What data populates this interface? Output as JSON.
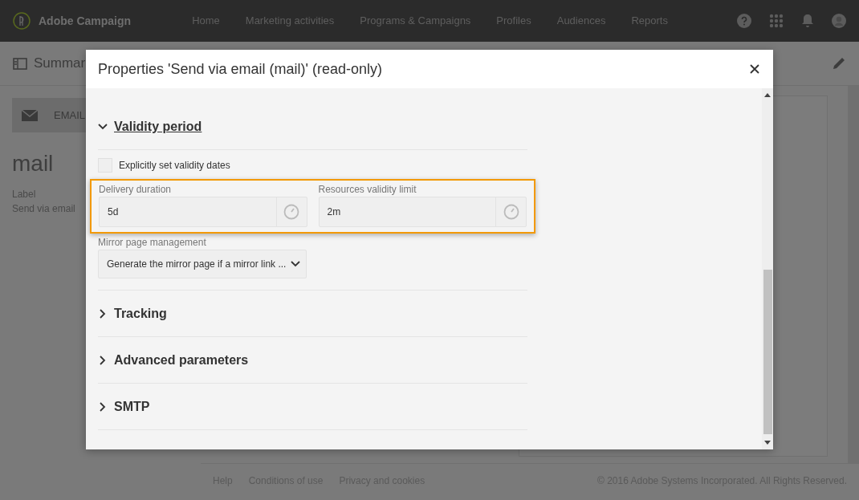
{
  "app": {
    "name": "Adobe Campaign",
    "nav": [
      {
        "label": "Home"
      },
      {
        "label": "Marketing activities"
      },
      {
        "label": "Programs & Campaigns"
      },
      {
        "label": "Profiles"
      },
      {
        "label": "Audiences"
      },
      {
        "label": "Reports"
      }
    ]
  },
  "page": {
    "summary_title": "Summar",
    "channel_tab": "EMAIL",
    "heading": "mail",
    "label_caption": "Label",
    "label_value": "Send via email"
  },
  "footer": {
    "links": [
      "Help",
      "Conditions of use",
      "Privacy and cookies"
    ],
    "copyright": "© 2016 Adobe Systems Incorporated. All Rights Reserved."
  },
  "dialog": {
    "title": "Properties 'Send via email (mail)' (read-only)",
    "sections": [
      {
        "title": "Validity period",
        "expanded": true,
        "rows": [
          {
            "kind": "checkbox",
            "label": "Explicitly set validity dates",
            "checked": false
          },
          {
            "kind": "pair",
            "highlighted": true,
            "fields": [
              {
                "label": "Delivery duration",
                "value": "5d"
              },
              {
                "label": "Resources validity limit",
                "value": "2m"
              }
            ]
          },
          {
            "kind": "select",
            "label": "Mirror page management",
            "value": "Generate the mirror page if a mirror link ..."
          }
        ]
      },
      {
        "title": "Tracking",
        "expanded": false
      },
      {
        "title": "Advanced parameters",
        "expanded": false
      },
      {
        "title": "SMTP",
        "expanded": false
      }
    ]
  }
}
